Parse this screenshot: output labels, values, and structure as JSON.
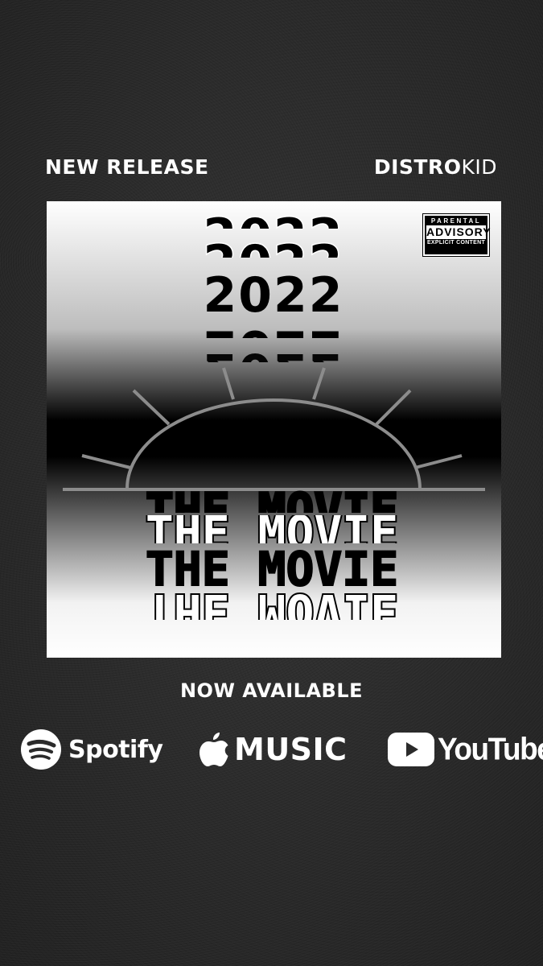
{
  "header": {
    "left_label": "NEW RELEASE",
    "brand_bold": "DISTRO",
    "brand_light": "KID"
  },
  "cover": {
    "year": "2022",
    "title": "THE MOVIE",
    "advisory": {
      "top": "PARENTAL",
      "middle": "ADVISORY",
      "bottom": "EXPLICIT CONTENT"
    }
  },
  "footer": {
    "cta": "NOW AVAILABLE",
    "platforms": [
      {
        "name": "Spotify",
        "icon": "spotify-icon"
      },
      {
        "name": "MUSIC",
        "icon": "apple-icon"
      },
      {
        "name": "YouTube",
        "icon": "youtube-play-icon"
      }
    ]
  },
  "colors": {
    "background": "#2b2b2b",
    "text": "#ffffff",
    "sun_line": "#8c8c8c"
  }
}
